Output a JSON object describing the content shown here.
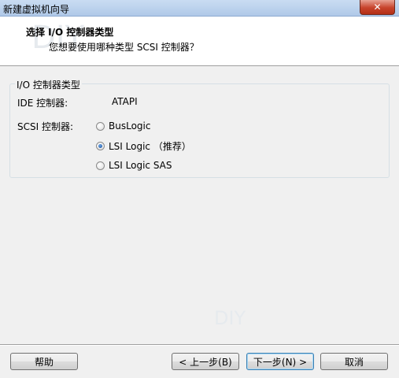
{
  "window": {
    "title": "新建虚拟机向导",
    "close_symbol": "✕"
  },
  "header": {
    "title": "选择 I/O 控制器类型",
    "subtitle": "您想要使用哪种类型 SCSI 控制器？"
  },
  "group": {
    "legend": "I/O 控制器类型",
    "ide_label": "IDE 控制器:",
    "ide_value": "ATAPI",
    "scsi_label": "SCSI 控制器:",
    "scsi_options": [
      {
        "label": "BusLogic",
        "checked": false
      },
      {
        "label": "LSI Logic （推荐）",
        "checked": true
      },
      {
        "label": "LSI Logic SAS",
        "checked": false
      }
    ]
  },
  "buttons": {
    "help": "帮助",
    "back": "< 上一步(B)",
    "next": "下一步(N) >",
    "cancel": "取消"
  }
}
